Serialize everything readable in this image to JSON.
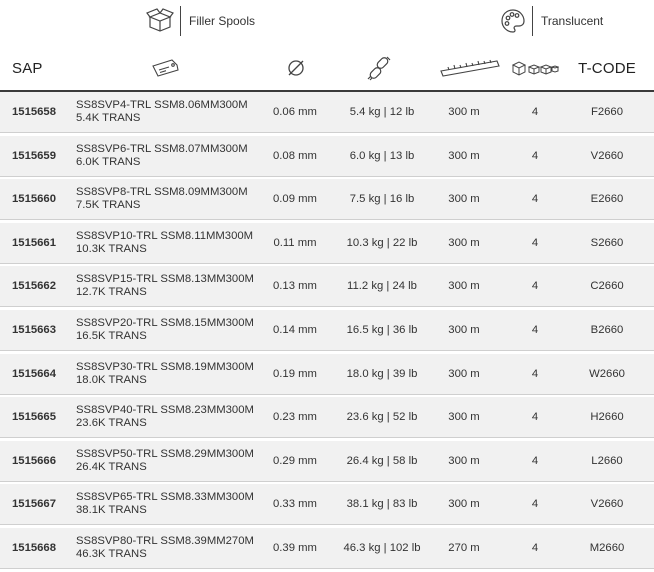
{
  "top": {
    "filler_label": "Filler Spools",
    "translucent_label": "Translucent"
  },
  "header": {
    "sap": "SAP",
    "tcode": "T-CODE",
    "icons": [
      "price-tag-icon",
      "diameter-icon",
      "chain-link-icon",
      "ruler-icon",
      "boxes-icon"
    ]
  },
  "rows": [
    {
      "sap": "1515658",
      "desc1": "SS8SVP4-TRL SSM8.06MM300M",
      "desc2": "5.4K TRANS",
      "diameter": "0.06 mm",
      "strength": "5.4 kg | 12 lb",
      "length": "300 m",
      "qty": "4",
      "tcode": "F2660"
    },
    {
      "sap": "1515659",
      "desc1": "SS8SVP6-TRL SSM8.07MM300M",
      "desc2": "6.0K TRANS",
      "diameter": "0.08 mm",
      "strength": "6.0 kg | 13 lb",
      "length": "300 m",
      "qty": "4",
      "tcode": "V2660"
    },
    {
      "sap": "1515660",
      "desc1": "SS8SVP8-TRL SSM8.09MM300M",
      "desc2": "7.5K TRANS",
      "diameter": "0.09 mm",
      "strength": "7.5 kg | 16 lb",
      "length": "300 m",
      "qty": "4",
      "tcode": "E2660"
    },
    {
      "sap": "1515661",
      "desc1": "SS8SVP10-TRL SSM8.11MM300M",
      "desc2": "10.3K TRANS",
      "diameter": "0.11 mm",
      "strength": "10.3 kg | 22 lb",
      "length": "300 m",
      "qty": "4",
      "tcode": "S2660"
    },
    {
      "sap": "1515662",
      "desc1": "SS8SVP15-TRL SSM8.13MM300M",
      "desc2": "12.7K TRANS",
      "diameter": "0.13 mm",
      "strength": "11.2 kg | 24 lb",
      "length": "300 m",
      "qty": "4",
      "tcode": "C2660"
    },
    {
      "sap": "1515663",
      "desc1": "SS8SVP20-TRL SSM8.15MM300M",
      "desc2": "16.5K TRANS",
      "diameter": "0.14 mm",
      "strength": "16.5 kg | 36 lb",
      "length": "300 m",
      "qty": "4",
      "tcode": "B2660"
    },
    {
      "sap": "1515664",
      "desc1": "SS8SVP30-TRL SSM8.19MM300M",
      "desc2": "18.0K TRANS",
      "diameter": "0.19 mm",
      "strength": "18.0 kg | 39 lb",
      "length": "300 m",
      "qty": "4",
      "tcode": "W2660"
    },
    {
      "sap": "1515665",
      "desc1": "SS8SVP40-TRL SSM8.23MM300M",
      "desc2": "23.6K TRANS",
      "diameter": "0.23 mm",
      "strength": "23.6 kg | 52 lb",
      "length": "300 m",
      "qty": "4",
      "tcode": "H2660"
    },
    {
      "sap": "1515666",
      "desc1": "SS8SVP50-TRL SSM8.29MM300M",
      "desc2": "26.4K TRANS",
      "diameter": "0.29 mm",
      "strength": "26.4 kg | 58 lb",
      "length": "300 m",
      "qty": "4",
      "tcode": "L2660"
    },
    {
      "sap": "1515667",
      "desc1": "SS8SVP65-TRL SSM8.33MM300M",
      "desc2": "38.1K TRANS",
      "diameter": "0.33 mm",
      "strength": "38.1 kg | 83 lb",
      "length": "300 m",
      "qty": "4",
      "tcode": "V2660"
    },
    {
      "sap": "1515668",
      "desc1": "SS8SVP80-TRL SSM8.39MM270M",
      "desc2": "46.3K TRANS",
      "diameter": "0.39 mm",
      "strength": "46.3 kg | 102 lb",
      "length": "270 m",
      "qty": "4",
      "tcode": "M2660"
    }
  ]
}
